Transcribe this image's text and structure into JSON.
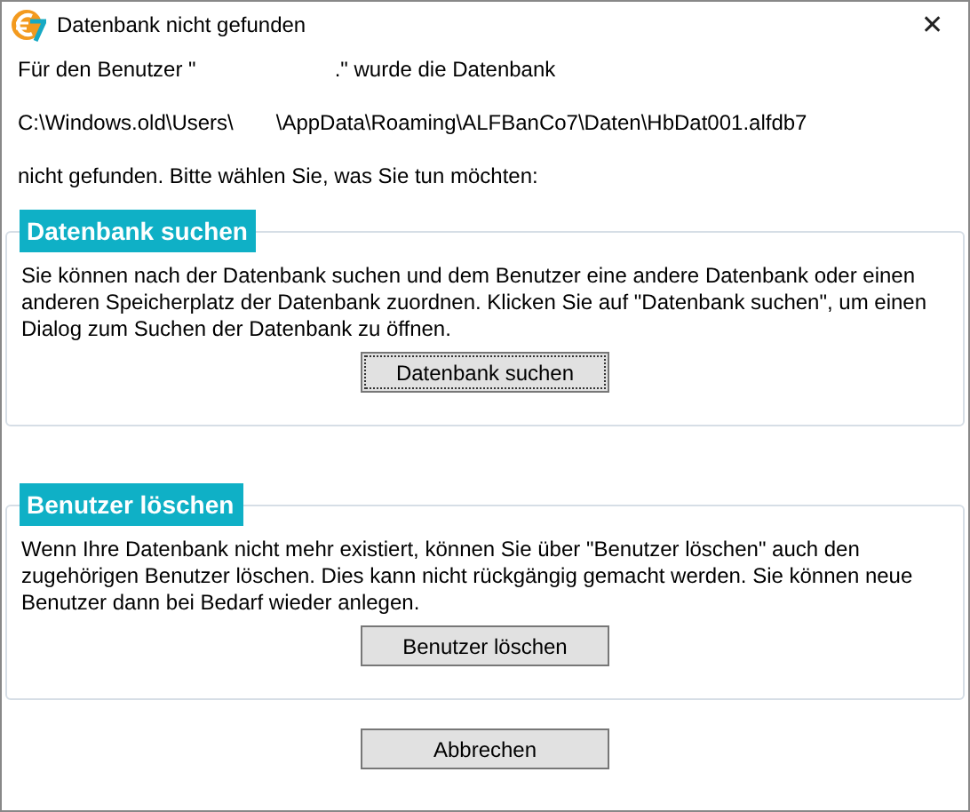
{
  "window": {
    "title": "Datenbank nicht gefunden",
    "close": "✕"
  },
  "message": [
    {
      "parts": [
        "Für den Benutzer \"",
        ".\" wurde die Datenbank"
      ]
    },
    {
      "parts": [
        "C:\\Windows.old\\Users\\",
        "\\AppData\\Roaming\\ALFBanCo7\\Daten\\HbDat001.alfdb7"
      ]
    },
    {
      "parts": [
        "nicht gefunden. Bitte wählen Sie, was Sie tun möchten:"
      ]
    }
  ],
  "sections": [
    {
      "title": "Datenbank suchen",
      "text": "Sie können nach der Datenbank suchen und dem Benutzer eine andere Datenbank oder einen anderen Speicherplatz der Datenbank zuordnen. Klicken Sie auf \"Datenbank suchen\", um einen Dialog zum Suchen der Datenbank zu öffnen.",
      "button": {
        "label": "Datenbank suchen",
        "focused": true
      }
    },
    {
      "title": "Benutzer löschen",
      "text": "Wenn Ihre Datenbank nicht mehr existiert, können Sie über \"Benutzer löschen\" auch den zugehörigen Benutzer löschen. Dies kann nicht rückgängig gemacht werden. Sie können neue Benutzer dann bei Bedarf wieder anlegen.",
      "button": {
        "label": "Benutzer löschen",
        "focused": false
      }
    }
  ],
  "cancel_button": {
    "label": "Abbrechen",
    "focused": false
  }
}
